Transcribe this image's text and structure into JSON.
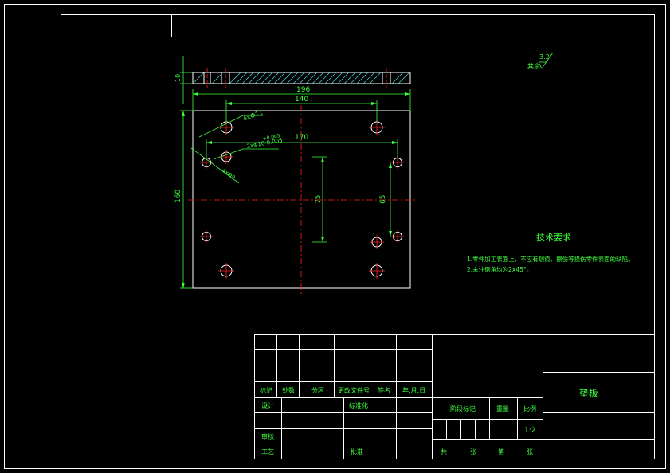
{
  "colors": {
    "background": "#000000",
    "frame": "#ffffff",
    "text": "#3dff3d",
    "centerline": "#ff2020",
    "hatch": "#4fd8e8",
    "dimension": "#3dff3d"
  },
  "drawing": {
    "roughness_note": "其余",
    "roughness_value": "3.2",
    "tech_title": "技术要求",
    "tech_line_1": "1.零件加工表面上，不应有划痕、擦伤等损伤零件表面的缺陷。",
    "tech_line_2": "2.未注倒角均为2x45°。",
    "dims": {
      "overall_width": "196",
      "hole_span_top": "140",
      "hole_span_mid": "170",
      "height": "160",
      "thickness": "10",
      "vertical_75": "75",
      "vertical_65": "65",
      "hole_note_1": "4xΦ11",
      "hole_note_2": "2xΦ10-0.005",
      "hole_note_2_tol": "+0.005",
      "hole_note_3": "4xΦ9"
    }
  },
  "title_block": {
    "part_name": "垫板",
    "row_labels": [
      "标记",
      "处数",
      "分区",
      "更改文件号",
      "签名",
      "年.月.日"
    ],
    "design": "设计",
    "standardize": "标准化",
    "review": "审核",
    "process": "工艺",
    "approve": "批准",
    "stage_mark": "阶段标记",
    "weight": "重量",
    "scale": "比例",
    "scale_value": "1:2",
    "sheets_total": "共",
    "sheets_label": "张",
    "sheet_no": "第",
    "sheet_label": "张"
  }
}
